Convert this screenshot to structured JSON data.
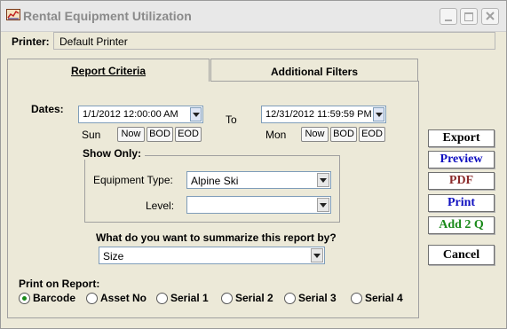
{
  "window": {
    "title": "Rental Equipment Utilization"
  },
  "printer": {
    "label": "Printer:",
    "value": "Default Printer"
  },
  "tabs": [
    {
      "label": "Report Criteria",
      "active": true
    },
    {
      "label": "Additional Filters",
      "active": false
    }
  ],
  "dates": {
    "label": "Dates:",
    "to_label": "To",
    "start": {
      "value": "1/1/2012 12:00:00 AM",
      "day": "Sun"
    },
    "end": {
      "value": "12/31/2012 11:59:59 PM",
      "day": "Mon"
    },
    "buttons": [
      "Now",
      "BOD",
      "EOD"
    ]
  },
  "show_only": {
    "title": "Show Only:",
    "equipment_type_label": "Equipment Type:",
    "equipment_type_value": "Alpine Ski",
    "level_label": "Level:",
    "level_value": ""
  },
  "summarize": {
    "question": "What do you want to summarize this report by?",
    "value": "Size"
  },
  "print_on_report": {
    "label": "Print on Report:",
    "options": [
      {
        "label": "Barcode",
        "selected": true
      },
      {
        "label": "Asset No",
        "selected": false
      },
      {
        "label": "Serial 1",
        "selected": false
      },
      {
        "label": "Serial 2",
        "selected": false
      },
      {
        "label": "Serial 3",
        "selected": false
      },
      {
        "label": "Serial 4",
        "selected": false
      }
    ]
  },
  "actions": [
    {
      "label": "Export",
      "color": "#000000"
    },
    {
      "label": "Preview",
      "color": "#1010c0"
    },
    {
      "label": "PDF",
      "color": "#8b2a2a"
    },
    {
      "label": "Print",
      "color": "#1010c0"
    },
    {
      "label": "Add 2 Q",
      "color": "#1a8a1a"
    },
    {
      "label": "Cancel",
      "color": "#000000"
    }
  ]
}
